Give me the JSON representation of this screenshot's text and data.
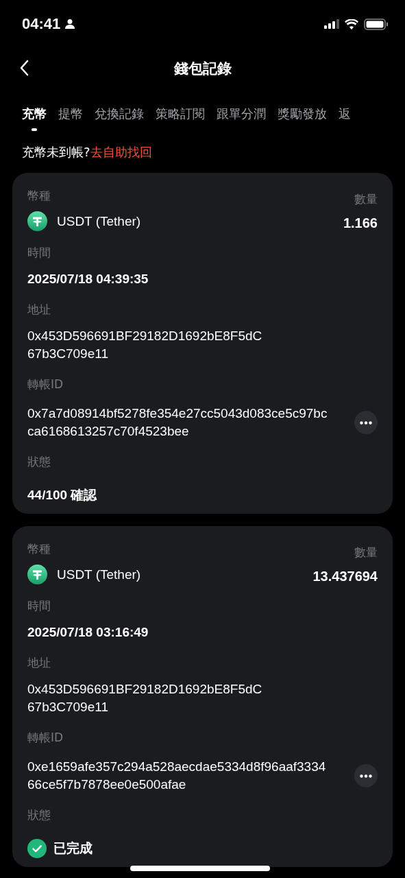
{
  "status_bar": {
    "time": "04:41"
  },
  "header": {
    "title": "錢包記錄"
  },
  "tabs": [
    {
      "label": "充幣",
      "selected": true
    },
    {
      "label": "提幣",
      "selected": false
    },
    {
      "label": "兌換記錄",
      "selected": false
    },
    {
      "label": "策略訂閱",
      "selected": false
    },
    {
      "label": "跟單分潤",
      "selected": false
    },
    {
      "label": "獎勵發放",
      "selected": false
    },
    {
      "label": "返",
      "selected": false
    }
  ],
  "notice": {
    "text": "充幣未到帳?",
    "link": "去自助找回"
  },
  "records": [
    {
      "coin_label": "幣種",
      "coin": "USDT (Tether)",
      "amount_label": "數量",
      "amount": "1.166",
      "time_label": "時間",
      "time": "2025/07/18 04:39:35",
      "address_label": "地址",
      "address": "0x453D596691BF29182D1692bE8F5dC67b3C709e11",
      "txid_label": "轉帳ID",
      "txid": "0x7a7d08914bf5278fe354e27cc5043d083ce5c97bcca6168613257c70f4523bee",
      "status_label": "狀態",
      "status": {
        "kind": "pending",
        "text": "44/100 確認"
      }
    },
    {
      "coin_label": "幣種",
      "coin": "USDT (Tether)",
      "amount_label": "數量",
      "amount": "13.437694",
      "time_label": "時間",
      "time": "2025/07/18 03:16:49",
      "address_label": "地址",
      "address": "0x453D596691BF29182D1692bE8F5dC67b3C709e11",
      "txid_label": "轉帳ID",
      "txid": "0xe1659afe357c294a528aecdae5334d8f96aaf333466ce5f7b7878ee0e500afae",
      "status_label": "狀態",
      "status": {
        "kind": "completed",
        "text": "已完成"
      }
    }
  ]
}
